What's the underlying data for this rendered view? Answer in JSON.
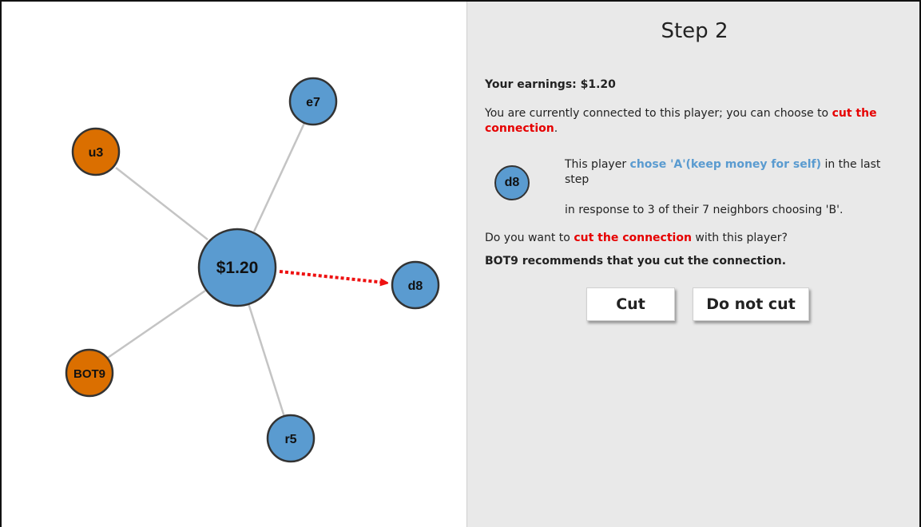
{
  "graph": {
    "center_node": {
      "label": "$1.20",
      "color": "#5a9bd0"
    },
    "nodes": [
      {
        "id": "e7",
        "label": "e7",
        "color": "#5a9bd0"
      },
      {
        "id": "u3",
        "label": "u3",
        "color": "#db6f00"
      },
      {
        "id": "d8",
        "label": "d8",
        "color": "#5a9bd0",
        "highlighted": true
      },
      {
        "id": "bot9",
        "label": "BOT9",
        "color": "#db6f00"
      },
      {
        "id": "r5",
        "label": "r5",
        "color": "#5a9bd0"
      }
    ],
    "edge_color": "#c4c4c4",
    "arrow_color": "#ee1111"
  },
  "panel": {
    "title": "Step 2",
    "earnings": "Your earnings: $1.20",
    "connected_text": "You are currently connected to this player; you can choose to ",
    "cut_phrase": "cut the connection",
    "period": ".",
    "player_label": "d8",
    "choice_prefix": "This player ",
    "choice_text": "chose 'A'(keep money for self)",
    "choice_suffix": " in the last step",
    "response_text": "in response to 3 of their 7 neighbors choosing 'B'.",
    "question_prefix": "Do you want to ",
    "question_cut": "cut the connection",
    "question_suffix": " with this player?",
    "recommendation": "BOT9 recommends that you cut the connection.",
    "buttons": {
      "cut": "Cut",
      "do_not_cut": "Do not cut"
    }
  }
}
